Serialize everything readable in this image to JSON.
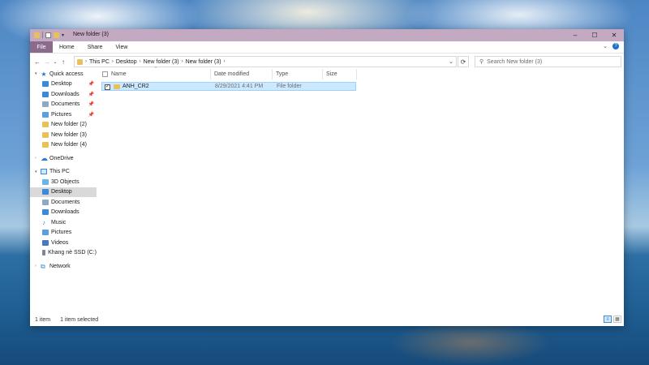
{
  "window": {
    "title": "New folder (3)",
    "controls": {
      "minimize": "–",
      "maximize": "☐",
      "close": "✕"
    }
  },
  "ribbon": {
    "tabs": [
      "File",
      "Home",
      "Share",
      "View"
    ],
    "expand_glyph": "⌄",
    "help_glyph": "?"
  },
  "navigation": {
    "back": "←",
    "forward": "→",
    "recent": "⌄",
    "up": "↑",
    "breadcrumb": [
      "This PC",
      "Desktop",
      "New folder (3)",
      "New folder (3)"
    ],
    "address_dropdown": "⌄",
    "refresh": "⟳",
    "search_placeholder": "Search New folder (3)"
  },
  "sidebar": {
    "quick_access": {
      "label": "Quick access",
      "items": [
        {
          "label": "Desktop",
          "icon": "desktop-icon",
          "pinned": true
        },
        {
          "label": "Downloads",
          "icon": "downloads-icon",
          "pinned": true
        },
        {
          "label": "Documents",
          "icon": "documents-icon",
          "pinned": true
        },
        {
          "label": "Pictures",
          "icon": "pictures-icon",
          "pinned": true
        },
        {
          "label": "New folder (2)",
          "icon": "folder-icon",
          "pinned": false
        },
        {
          "label": "New folder (3)",
          "icon": "folder-icon",
          "pinned": false
        },
        {
          "label": "New folder (4)",
          "icon": "folder-icon",
          "pinned": false
        }
      ]
    },
    "onedrive": {
      "label": "OneDrive"
    },
    "this_pc": {
      "label": "This PC",
      "items": [
        {
          "label": "3D Objects",
          "icon": "3d-objects-icon"
        },
        {
          "label": "Desktop",
          "icon": "desktop-icon",
          "selected": true
        },
        {
          "label": "Documents",
          "icon": "documents-icon"
        },
        {
          "label": "Downloads",
          "icon": "downloads-icon"
        },
        {
          "label": "Music",
          "icon": "music-icon"
        },
        {
          "label": "Pictures",
          "icon": "pictures-icon"
        },
        {
          "label": "Videos",
          "icon": "videos-icon"
        },
        {
          "label": "Khang nè SSD (C:)",
          "icon": "drive-icon"
        }
      ]
    },
    "network": {
      "label": "Network"
    },
    "pin_glyph": "📌"
  },
  "file_list": {
    "columns": [
      "Name",
      "Date modified",
      "Type",
      "Size"
    ],
    "sort_glyph": "^",
    "rows": [
      {
        "name": "ANH_CR2",
        "date_modified": "8/29/2021 4:41 PM",
        "type": "File folder",
        "size": "",
        "selected": true
      }
    ]
  },
  "status": {
    "item_count": "1 item",
    "selection": "1 item selected"
  },
  "colors": {
    "titlebar": "#c3a9c2",
    "file_tab": "#8c6a8c",
    "selection": "#cce8ff",
    "folder": "#e8c15b",
    "accent": "#1e6fc7"
  }
}
